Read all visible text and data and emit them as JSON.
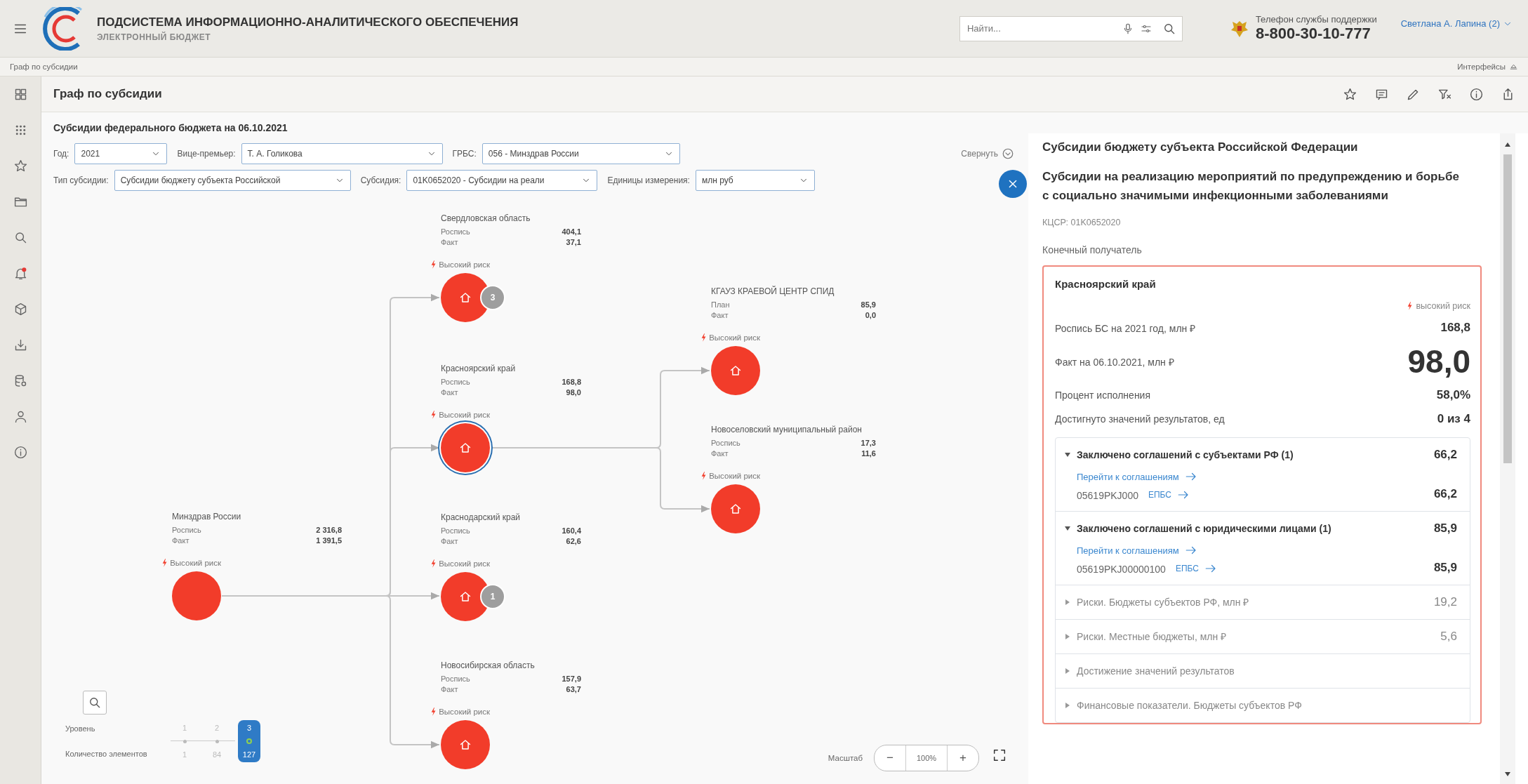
{
  "header": {
    "title": "ПОДСИСТЕМА ИНФОРМАЦИОННО-АНАЛИТИЧЕСКОГО ОБЕСПЕЧЕНИЯ",
    "subtitle": "ЭЛЕКТРОННЫЙ БЮДЖЕТ",
    "search": {
      "placeholder": "Найти..."
    },
    "support": {
      "label": "Телефон службы поддержки",
      "phone": "8-800-30-10-777"
    },
    "user": "Светлана А. Лапина (2)"
  },
  "breadcrumb": {
    "path": "Граф по субсидии",
    "interfaces": "Интерфейсы"
  },
  "page": {
    "title": "Граф по субсидии"
  },
  "filters": {
    "title": "Субсидии федерального бюджета на 06.10.2021",
    "collapse": "Свернуть",
    "rows": [
      {
        "fields": [
          {
            "label": "Год:",
            "value": "2021"
          },
          {
            "label": "Вице-премьер:",
            "value": "Т. А. Голикова"
          },
          {
            "label": "ГРБС:",
            "value": "056 - Минздрав России"
          }
        ]
      },
      {
        "fields": [
          {
            "label": "Тип субсидии:",
            "value": "Субсидии бюджету субъекта Российской"
          },
          {
            "label": "Субсидия:",
            "value": "01K0652020 - Субсидии на реали"
          },
          {
            "label": "Единицы измерения:",
            "value": "млн руб"
          }
        ]
      }
    ]
  },
  "graph": {
    "nodes": [
      {
        "name": "Минздрав России",
        "kind": "ministry",
        "rows": [
          {
            "label": "Роспись",
            "value": "2 316,8"
          },
          {
            "label": "Факт",
            "value": "1 391,5"
          }
        ],
        "risk": "Высокий риск",
        "selected": false,
        "children": [
          {
            "name": "Свердловская область",
            "kind": "region",
            "rows": [
              {
                "label": "Роспись",
                "value": "404,1"
              },
              {
                "label": "Факт",
                "value": "37,1"
              }
            ],
            "risk": "Высокий риск",
            "badge": "3",
            "selected": false
          },
          {
            "name": "Красноярский край",
            "kind": "region",
            "rows": [
              {
                "label": "Роспись",
                "value": "168,8"
              },
              {
                "label": "Факт",
                "value": "98,0"
              }
            ],
            "risk": "Высокий риск",
            "selected": true,
            "children": [
              {
                "name": "КГАУЗ КРАЕВОЙ ЦЕНТР СПИД",
                "kind": "institution",
                "rows": [
                  {
                    "label": "План",
                    "value": "85,9"
                  },
                  {
                    "label": "Факт",
                    "value": "0,0"
                  }
                ],
                "risk": "Высокий риск",
                "selected": false
              },
              {
                "name": "Новоселовский муниципальный район",
                "kind": "institution",
                "rows": [
                  {
                    "label": "Роспись",
                    "value": "17,3"
                  },
                  {
                    "label": "Факт",
                    "value": "11,6"
                  }
                ],
                "risk": "Высокий риск",
                "selected": false
              }
            ]
          },
          {
            "name": "Краснодарский край",
            "kind": "region",
            "rows": [
              {
                "label": "Роспись",
                "value": "160,4"
              },
              {
                "label": "Факт",
                "value": "62,6"
              }
            ],
            "risk": "Высокий риск",
            "badge": "1",
            "selected": false
          },
          {
            "name": "Новосибирская область",
            "kind": "region",
            "rows": [
              {
                "label": "Роспись",
                "value": "157,9"
              },
              {
                "label": "Факт",
                "value": "63,7"
              }
            ],
            "risk": "Высокий риск",
            "selected": false
          }
        ]
      }
    ],
    "levels": {
      "level_label": "Уровень",
      "count_label": "Количество элементов",
      "steps": [
        {
          "level": "1",
          "count": "1",
          "selected": false
        },
        {
          "level": "2",
          "count": "84",
          "selected": false
        },
        {
          "level": "3",
          "count": "127",
          "selected": true
        }
      ]
    },
    "zoom": {
      "label": "Масштаб",
      "minus": "−",
      "value": "100%",
      "plus": "+"
    }
  },
  "detail": {
    "category": "Субсидии бюджету субъекта Российской Федерации",
    "title": "Субсидии на реализацию мероприятий по предупреждению и борьбе с социально значимыми инфекционными заболеваниями",
    "code": "КЦСР: 01K0652020",
    "recipient_label": "Конечный получатель",
    "card": {
      "name": "Красноярский край",
      "risk": "высокий риск",
      "rows": [
        {
          "label": "Роспись БС на 2021 год, млн ₽",
          "value": "168,8",
          "kind": "normal"
        },
        {
          "label": "Факт на 06.10.2021, млн ₽",
          "value": "98,0",
          "kind": "large"
        },
        {
          "label": "Процент исполнения",
          "value": "58,0%",
          "kind": "normal"
        },
        {
          "label": "Достигнуто значений результатов, ед",
          "value": "0 из 4",
          "kind": "normal"
        }
      ],
      "sections": [
        {
          "title": "Заключено соглашений с субъектами РФ (1)",
          "value": "66,2",
          "expanded": true,
          "link": "Перейти к соглашениям",
          "agreements": [
            {
              "code": "05619PKJ000",
              "link": "ЕПБС",
              "value": "66,2"
            }
          ]
        },
        {
          "title": "Заключено соглашений с юридическими лицами (1)",
          "value": "85,9",
          "expanded": true,
          "link": "Перейти к соглашениям",
          "agreements": [
            {
              "code": "05619PKJ00000100",
              "link": "ЕПБС",
              "value": "85,9"
            }
          ]
        },
        {
          "title": "Риски. Бюджеты субъектов РФ, млн ₽",
          "value": "19,2",
          "expanded": false
        },
        {
          "title": "Риски. Местные бюджеты, млн ₽",
          "value": "5,6",
          "expanded": false
        },
        {
          "title": "Достижение значений результатов",
          "expanded": false
        },
        {
          "title": "Финансовые показатели. Бюджеты субъектов РФ",
          "expanded": false
        }
      ]
    }
  }
}
